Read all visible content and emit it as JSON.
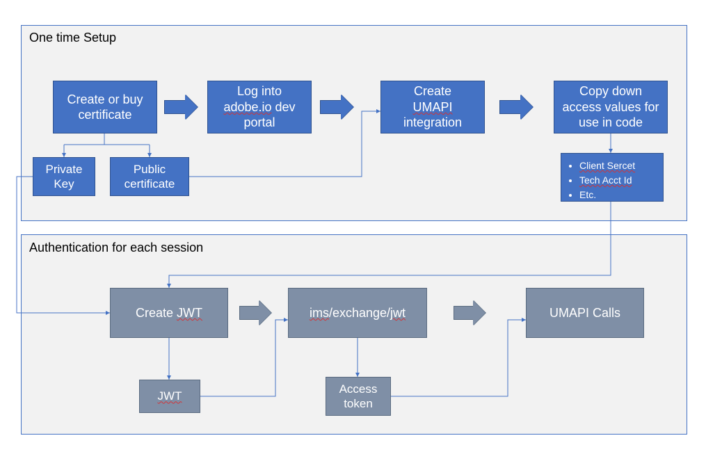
{
  "diagram": {
    "setup": {
      "title": "One time Setup",
      "steps": {
        "cert": "Create or buy certificate",
        "login_l1": "Log into",
        "login_l2_a": "adobe.io",
        "login_l2_b": " dev",
        "login_l3": "portal",
        "create_l1": "Create",
        "create_l2": "UMAPI",
        "create_l3": "integration",
        "copy": "Copy down access values for  use in code",
        "priv_key": "Private Key",
        "pub_cert": "Public certificate"
      },
      "values": {
        "items": [
          "Client Sercet",
          "Tech Acct Id",
          "Etc."
        ]
      }
    },
    "auth": {
      "title": "Authentication for each session",
      "steps": {
        "create_jwt_l1": "Create ",
        "create_jwt_l2": "JWT",
        "ims_a": "ims",
        "ims_b": "/exchange/",
        "ims_c": "jwt",
        "umapi": "UMAPI Calls",
        "jwt": "JWT",
        "access_token": "Access token"
      }
    }
  }
}
